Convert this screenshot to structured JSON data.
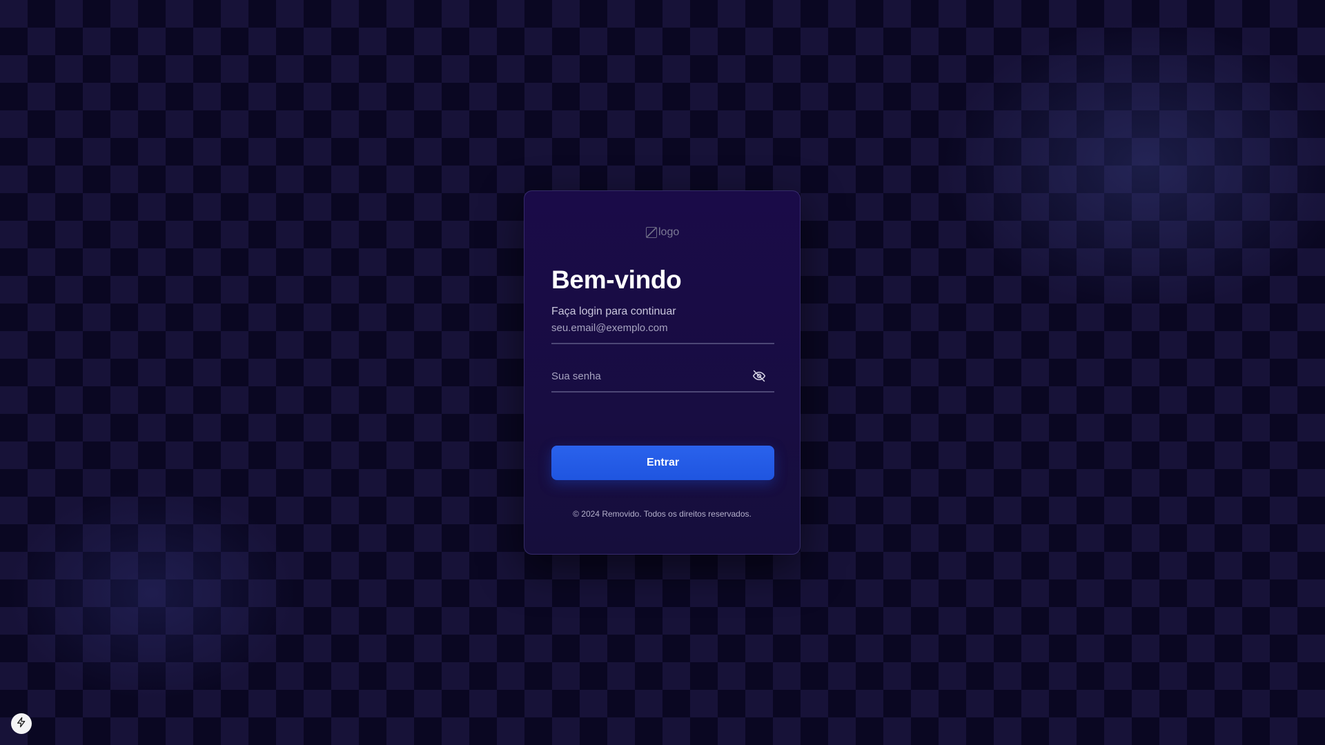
{
  "logo": {
    "alt_text": "logo"
  },
  "login": {
    "title": "Bem-vindo",
    "subtitle": "Faça login para continuar",
    "email_placeholder": "seu.email@exemplo.com",
    "email_value": "",
    "password_placeholder": "Sua senha",
    "password_value": "",
    "submit_label": "Entrar",
    "footer": "© 2024 Removido. Todos os direitos reservados."
  },
  "icons": {
    "password_toggle": "eye-off-icon",
    "corner": "lightning-icon"
  },
  "colors": {
    "background": "#0d0a26",
    "card": "#1a0b48",
    "accent": "#2a62ec",
    "text": "#ffffff",
    "muted": "#c9c6dc"
  }
}
